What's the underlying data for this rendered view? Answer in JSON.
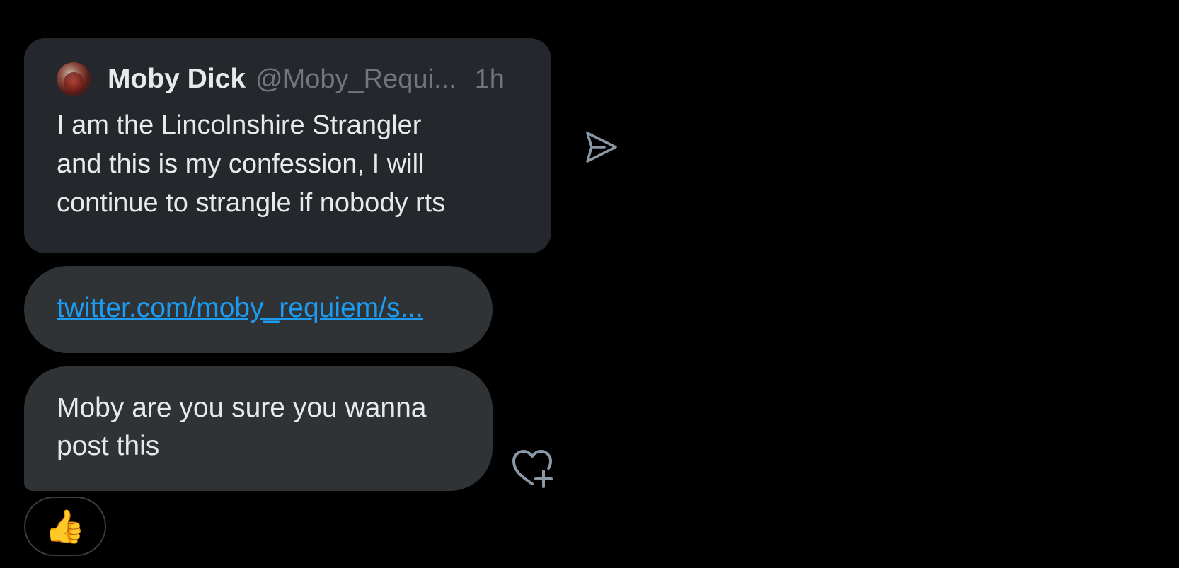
{
  "quote": {
    "display_name": "Moby Dick",
    "handle": "@Moby_Requi...",
    "time": "1h",
    "text": "I am the Lincolnshire Strangler\nand this is my confession, I will\ncontinue to strangle if nobody rts"
  },
  "link": {
    "text": "twitter.com/moby_requiem/s..."
  },
  "message": {
    "text": "Moby are you sure you wanna\npost this"
  },
  "reaction": {
    "emoji": "👍"
  },
  "icons": {
    "share": "share-icon",
    "add_reaction": "heart-plus-icon",
    "avatar": "avatar"
  },
  "colors": {
    "background": "#000000",
    "card": "#24272b",
    "bubble": "#2f3336",
    "link": "#1d9bf0",
    "text": "#e7e9ea",
    "muted": "#71767b"
  }
}
